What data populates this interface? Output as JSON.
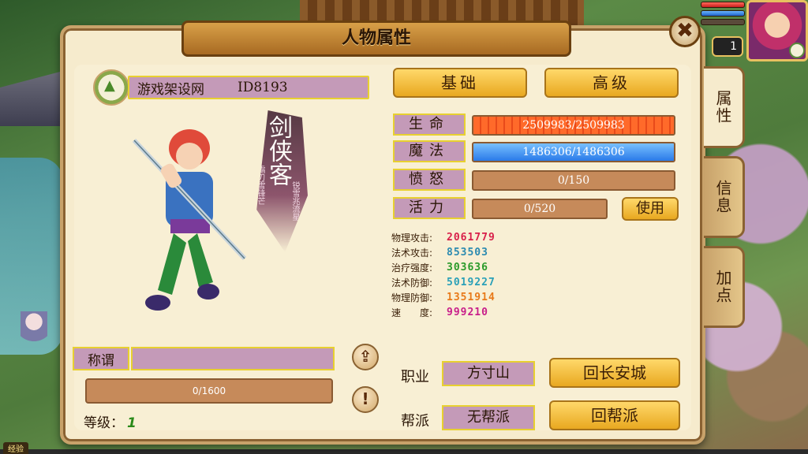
{
  "window": {
    "title": "人物属性"
  },
  "side_tabs": [
    {
      "label": "属性",
      "active": true
    },
    {
      "label": "信息",
      "active": false
    },
    {
      "label": "加点",
      "active": false
    }
  ],
  "player": {
    "level": "1",
    "hp_fill": 1.0,
    "mp_fill": 1.0
  },
  "profile": {
    "name": "游戏架设网",
    "id": "ID8193",
    "title_label": "称谓",
    "title_value": "",
    "exp": "0/1600",
    "level_label": "等级：",
    "level_value": "1"
  },
  "illustration": {
    "class_name": "剑侠客",
    "tagline_1": "霜刃雪锋芒",
    "tagline_2": "锐雪兆流星"
  },
  "tabs": {
    "basic": "基础",
    "advanced": "高级"
  },
  "stats": [
    {
      "label": "生命",
      "value": "2509983/2509983",
      "fill": 1.0,
      "kind": "hp"
    },
    {
      "label": "魔法",
      "value": "1486306/1486306",
      "fill": 1.0,
      "kind": "mp"
    },
    {
      "label": "愤怒",
      "value": "0/150",
      "fill": 0,
      "kind": "rage"
    },
    {
      "label": "活力",
      "value": "0/520",
      "fill": 0,
      "kind": "vitality"
    }
  ],
  "use_button": "使用",
  "attributes": [
    {
      "key": "物理攻击:",
      "value": "2061779",
      "color": "#d8204a"
    },
    {
      "key": "法术攻击:",
      "value": "853503",
      "color": "#2a8ab0"
    },
    {
      "key": "治疗强度:",
      "value": "303636",
      "color": "#2a9a2a"
    },
    {
      "key": "法术防御:",
      "value": "5019227",
      "color": "#2aa0b8"
    },
    {
      "key": "物理防御:",
      "value": "1351914",
      "color": "#e87a1a"
    },
    {
      "key": "速　　度:",
      "value": "999210",
      "color": "#c81e8a"
    }
  ],
  "career": {
    "label": "职业",
    "value": "方寸山",
    "button": "回长安城"
  },
  "guild": {
    "label": "帮派",
    "value": "无帮派",
    "button": "回帮派"
  },
  "hud": {
    "exp_label": "经验"
  },
  "colors": {
    "panel_bg": "#f6ebcd",
    "label_bg": "#c49ab8",
    "label_border": "#e8d030",
    "button": "#ffd86a"
  }
}
